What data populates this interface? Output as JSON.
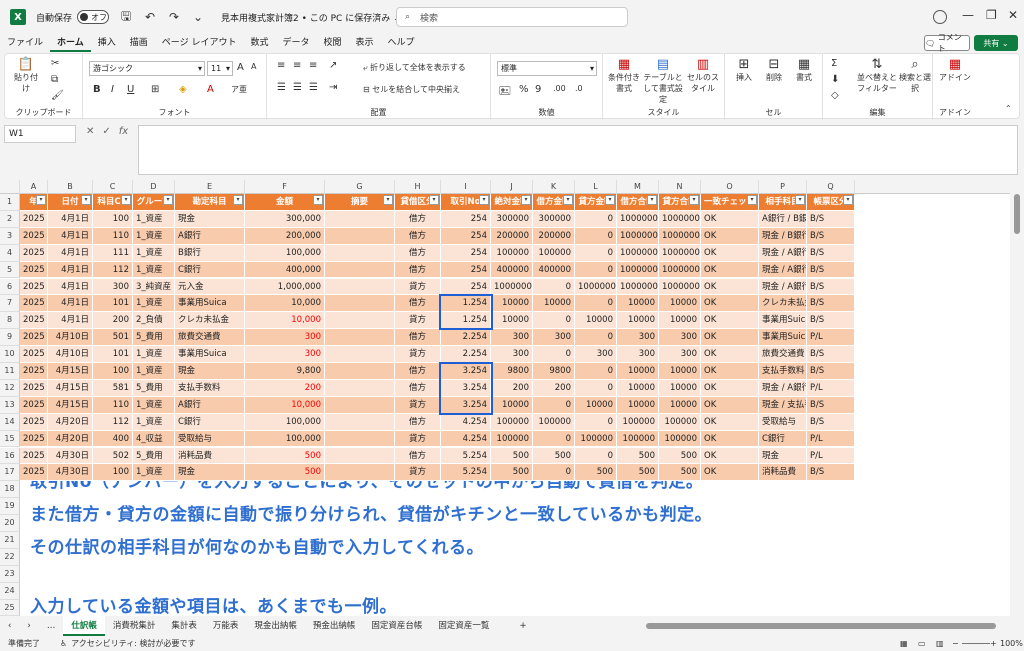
{
  "titlebar": {
    "app_icon": "X",
    "autosave_label": "自動保存",
    "toggle_label": "オフ",
    "doc_title": "見本用複式家計簿2 • この PC に保存済み ⌄",
    "search_placeholder": "検索"
  },
  "menu": [
    "ファイル",
    "ホーム",
    "挿入",
    "描画",
    "ページ レイアウト",
    "数式",
    "データ",
    "校閲",
    "表示",
    "ヘルプ"
  ],
  "active_menu": "ホーム",
  "comment_label": "コメント",
  "share_label": "共有",
  "ribbon": {
    "paste": "貼り付け",
    "clipboard": "クリップボード",
    "font_name": "游ゴシック",
    "font_size": "11",
    "font_group": "フォント",
    "wrap_text": "折り返して全体を表示する",
    "merge_center": "セルを結合して中央揃え",
    "alignment_group": "配置",
    "number_format": "標準",
    "number_group": "数値",
    "cond_format": "条件付き書式",
    "table_format": "テーブルとして書式設定",
    "cell_style": "セルのスタイル",
    "style_group": "スタイル",
    "insert": "挿入",
    "delete": "削除",
    "format": "書式",
    "cells_group": "セル",
    "sort_filter": "並べ替えとフィルター",
    "find_select": "検索と選択",
    "edit_group": "編集",
    "addin": "アドイン",
    "addin_group": "アドイン"
  },
  "formula_bar": {
    "name_box": "W1",
    "fx": "fx"
  },
  "columns": [
    "A",
    "B",
    "C",
    "D",
    "E",
    "F",
    "G",
    "H",
    "I",
    "J",
    "K",
    "L",
    "M",
    "N",
    "O",
    "P",
    "Q"
  ],
  "header_row": [
    "年",
    "日付",
    "科目CD",
    "グループ",
    "勘定科目",
    "金額",
    "摘要",
    "貸借区分",
    "取引No",
    "絶対金額",
    "借方金額",
    "貸方金額",
    "借方合計",
    "貸方合計",
    "一致チェック",
    "相手科目",
    "帳票区分"
  ],
  "rows": [
    [
      "2025",
      "4月1日",
      "100",
      "1_資産",
      "現金",
      "300,000",
      "",
      "借方",
      "254",
      "300000",
      "300000",
      "0",
      "1000000",
      "1000000",
      "OK",
      "A銀行 / B銀行",
      "B/S"
    ],
    [
      "2025",
      "4月1日",
      "110",
      "1_資産",
      "A銀行",
      "200,000",
      "",
      "借方",
      "254",
      "200000",
      "200000",
      "0",
      "1000000",
      "1000000",
      "OK",
      "現金 / B銀行",
      "B/S"
    ],
    [
      "2025",
      "4月1日",
      "111",
      "1_資産",
      "B銀行",
      "100,000",
      "",
      "借方",
      "254",
      "100000",
      "100000",
      "0",
      "1000000",
      "1000000",
      "OK",
      "現金 / A銀行",
      "B/S"
    ],
    [
      "2025",
      "4月1日",
      "112",
      "1_資産",
      "C銀行",
      "400,000",
      "",
      "借方",
      "254",
      "400000",
      "400000",
      "0",
      "1000000",
      "1000000",
      "OK",
      "現金 / A銀行",
      "B/S"
    ],
    [
      "2025",
      "4月1日",
      "300",
      "3_純資産",
      "元入金",
      "1,000,000",
      "",
      "貸方",
      "254",
      "1000000",
      "0",
      "1000000",
      "1000000",
      "1000000",
      "OK",
      "現金 / A銀行",
      "B/S"
    ],
    [
      "2025",
      "4月1日",
      "101",
      "1_資産",
      "事業用Suica",
      "10,000",
      "",
      "借方",
      "1.254",
      "10000",
      "10000",
      "0",
      "10000",
      "10000",
      "OK",
      "クレカ未払金",
      "B/S"
    ],
    [
      "2025",
      "4月1日",
      "200",
      "2_負債",
      "クレカ未払金",
      "10,000",
      "",
      "貸方",
      "1.254",
      "10000",
      "0",
      "10000",
      "10000",
      "10000",
      "OK",
      "事業用Suica",
      "B/S"
    ],
    [
      "2025",
      "4月10日",
      "501",
      "5_費用",
      "旅費交通費",
      "300",
      "",
      "借方",
      "2.254",
      "300",
      "300",
      "0",
      "300",
      "300",
      "OK",
      "事業用Suica",
      "P/L"
    ],
    [
      "2025",
      "4月10日",
      "101",
      "1_資産",
      "事業用Suica",
      "300",
      "",
      "貸方",
      "2.254",
      "300",
      "0",
      "300",
      "300",
      "300",
      "OK",
      "旅費交通費",
      "B/S"
    ],
    [
      "2025",
      "4月15日",
      "100",
      "1_資産",
      "現金",
      "9,800",
      "",
      "借方",
      "3.254",
      "9800",
      "9800",
      "0",
      "10000",
      "10000",
      "OK",
      "支払手数料",
      "B/S"
    ],
    [
      "2025",
      "4月15日",
      "581",
      "5_費用",
      "支払手数料",
      "200",
      "",
      "借方",
      "3.254",
      "200",
      "200",
      "0",
      "10000",
      "10000",
      "OK",
      "現金 / A銀行",
      "P/L"
    ],
    [
      "2025",
      "4月15日",
      "110",
      "1_資産",
      "A銀行",
      "10,000",
      "",
      "貸方",
      "3.254",
      "10000",
      "0",
      "10000",
      "10000",
      "10000",
      "OK",
      "現金 / 支払手",
      "B/S"
    ],
    [
      "2025",
      "4月20日",
      "112",
      "1_資産",
      "C銀行",
      "100,000",
      "",
      "借方",
      "4.254",
      "100000",
      "100000",
      "0",
      "100000",
      "100000",
      "OK",
      "受取給与",
      "B/S"
    ],
    [
      "2025",
      "4月20日",
      "400",
      "4_収益",
      "受取給与",
      "100,000",
      "",
      "貸方",
      "4.254",
      "100000",
      "0",
      "100000",
      "100000",
      "100000",
      "OK",
      "C銀行",
      "P/L"
    ],
    [
      "2025",
      "4月30日",
      "502",
      "5_費用",
      "消耗品費",
      "500",
      "",
      "借方",
      "5.254",
      "500",
      "500",
      "0",
      "500",
      "500",
      "OK",
      "現金",
      "P/L"
    ],
    [
      "2025",
      "4月30日",
      "100",
      "1_資産",
      "現金",
      "500",
      "",
      "貸方",
      "5.254",
      "500",
      "0",
      "500",
      "500",
      "500",
      "OK",
      "消耗品費",
      "B/S"
    ]
  ],
  "red_amount_rows": [
    6,
    7,
    8,
    10,
    11,
    14,
    15
  ],
  "annotation": {
    "line1": "取引No（ナンバー）を入力することにより、そのセットの中から自動で貸借を判定。",
    "line2": "また借方・貸方の金額に自動で振り分けられ、貸借がキチンと一致しているかも判定。",
    "line3": "その仕訳の相手科目が何なのかも自動で入力してくれる。",
    "line4": "入力している金額や項目は、あくまでも一例。"
  },
  "tabs": [
    "仕訳帳",
    "消費税集計",
    "集計表",
    "万能表",
    "現金出納帳",
    "預金出納帳",
    "固定資産台帳",
    "固定資産一覧"
  ],
  "active_tab": "仕訳帳",
  "status": {
    "ready": "準備完了",
    "accessibility": "アクセシビリティ: 検討が必要です",
    "zoom": "100%"
  },
  "colors": {
    "excel_green": "#107c41",
    "header_orange": "#ed7d31",
    "band_light": "#fbe4d5",
    "band_dark": "#f8cbad",
    "annotation_blue": "#2f6fd0",
    "highlight_box": "#1f5fd6"
  }
}
